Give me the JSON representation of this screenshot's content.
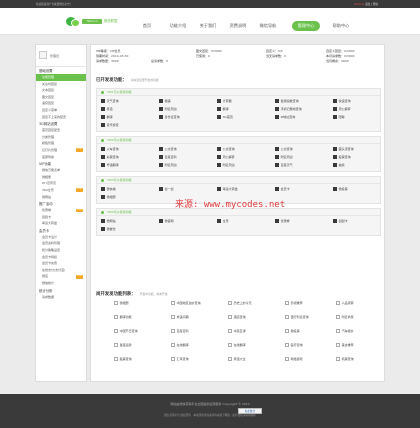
{
  "topbar": {
    "left": "欢迎您来到广告联盟微信平台！",
    "user": "adchina",
    "links": "退出 | 帮助"
  },
  "header": {
    "logo_small": "Yemx.cn",
    "logo_text": "微信联盟"
  },
  "nav": [
    "首页",
    "功能介绍",
    "关于我们",
    "资费说明",
    "微信导航",
    "管理中心",
    "帮助中心"
  ],
  "nav_active": 5,
  "sidebar": {
    "username": "管理员",
    "groups": [
      {
        "title": "基础设置",
        "items": [
          {
            "label": "功能管理",
            "sel": true
          },
          {
            "label": "关注时回复"
          },
          {
            "label": "文本回复"
          },
          {
            "label": "图文回复"
          },
          {
            "label": "语音回复"
          },
          {
            "label": "自定义菜单"
          },
          {
            "label": "回复不上来的配置"
          }
        ]
      },
      {
        "title": "3G网站设置",
        "items": [
          {
            "label": "首页回复配置"
          },
          {
            "label": "分类管理"
          },
          {
            "label": "模板管理"
          },
          {
            "label": "幻灯片管理",
            "tag": "new"
          },
          {
            "label": "底部导航"
          }
        ]
      },
      {
        "title": "VIP功能",
        "items": [
          {
            "label": "微信万能表单"
          },
          {
            "label": "微相册"
          },
          {
            "label": "DIY宣传页"
          },
          {
            "label": "360全景",
            "tag": "new"
          },
          {
            "label": "微网站"
          }
        ]
      },
      {
        "title": "推广活动",
        "items": [
          {
            "label": "优惠券",
            "tag": "new"
          },
          {
            "label": "刮刮卡"
          },
          {
            "label": "幸运大转盘"
          }
        ]
      },
      {
        "title": "会员卡",
        "items": [
          {
            "label": "会员卡设计"
          },
          {
            "label": "会员资料管理"
          },
          {
            "label": "积分策略设置"
          },
          {
            "label": "会员卡特权"
          },
          {
            "label": "会员卡充值"
          },
          {
            "label": "在线支付(支付宝)"
          },
          {
            "label": "微店",
            "tag": "new"
          },
          {
            "label": "微信统计"
          }
        ]
      },
      {
        "title": "统计分析",
        "items": [
          {
            "label": "请求数据"
          }
        ]
      }
    ]
  },
  "info": {
    "vip_label": "VIP等级：",
    "vip_value": "VIP会员",
    "expire_label": "到期时间：",
    "expire_value": "2014-03-30",
    "req_label": "请求数量：",
    "req_value": "3000",
    "gallery_label": "图文回复：",
    "gallery_value": "0/3000",
    "used_label": "已使用：",
    "used_value": "0",
    "custom_label": "自定义：",
    "custom_value": "0/5",
    "text_label": "自定义回复：",
    "text_value": "0/3000",
    "today_label": "当天请求数：",
    "today_value": "0",
    "total_label": "总请求数：",
    "total_value": "0",
    "month_label": "本月请求数：",
    "month_value": "0/3000",
    "remain_label": "当月剩余：",
    "remain_value": "3000"
  },
  "secA": {
    "title": "已开发发功能：",
    "hint": "请勾选需要开启的功能",
    "groups": [
      {
        "head": "VIP1可以使用功能",
        "opts": [
          {
            "t": "天气查询",
            "on": true
          },
          {
            "t": "糗事",
            "on": true
          },
          {
            "t": "计算器",
            "on": true
          },
          {
            "t": "健康指数查询",
            "on": true
          },
          {
            "t": "快递查询",
            "on": true
          },
          {
            "t": "笑话",
            "on": true
          },
          {
            "t": "附近周边",
            "on": true
          },
          {
            "t": "翻译",
            "on": true
          },
          {
            "t": "手机归属地查询",
            "on": true
          },
          {
            "t": "周公解梦",
            "on": true
          },
          {
            "t": "翻译",
            "on": true
          },
          {
            "t": "身份证查询",
            "on": true
          },
          {
            "t": "3G首页",
            "on": true
          },
          {
            "t": "IP地址查询",
            "on": true
          },
          {
            "t": "陪聊",
            "on": true
          },
          {
            "t": "音乐搜索",
            "on": true
          }
        ]
      },
      {
        "head": "VIP2可以使用功能",
        "opts": [
          {
            "t": "火车查询",
            "on": true
          },
          {
            "t": "公交查询",
            "on": true
          },
          {
            "t": "公交查询",
            "on": true
          },
          {
            "t": "公交查询",
            "on": true
          },
          {
            "t": "藏头诗查询",
            "on": true
          },
          {
            "t": "彩票查询",
            "on": true
          },
          {
            "t": "百度百科",
            "on": true
          },
          {
            "t": "周公解梦",
            "on": true
          },
          {
            "t": "附近周边",
            "on": true
          },
          {
            "t": "股票查询",
            "on": true
          },
          {
            "t": "粤语翻译",
            "on": true
          },
          {
            "t": "附近周边",
            "on": true
          },
          {
            "t": "附近周边",
            "on": true
          },
          {
            "t": "百度天气",
            "on": true
          },
          {
            "t": "抽奖",
            "on": true
          }
        ]
      },
      {
        "head": "VIP3可以使用功能",
        "opts": [
          {
            "t": "微信墙",
            "on": true
          },
          {
            "t": "摇一摇",
            "on": true
          },
          {
            "t": "幸运大转盘",
            "on": true
          },
          {
            "t": "会员卡",
            "on": true
          },
          {
            "t": "微投票",
            "on": true
          },
          {
            "t": "微相册",
            "on": true
          }
        ]
      },
      {
        "head": "VIP4可以使用功能",
        "opts": [
          {
            "t": "微网站",
            "on": true
          },
          {
            "t": "微官网",
            "on": true
          },
          {
            "t": "全景",
            "on": true
          },
          {
            "t": "优惠券",
            "on": true
          },
          {
            "t": "刮刮卡",
            "on": true
          },
          {
            "t": "微餐饮",
            "on": true
          }
        ]
      }
    ]
  },
  "secB": {
    "title": "尚开发发功能列表：",
    "hint": "开发中功能，尚未开放",
    "cells": [
      {
        "t": "微相册",
        "on": false
      },
      {
        "t": "中国地区油价查询",
        "on": false
      },
      {
        "t": "历史上的今天",
        "on": false
      },
      {
        "t": "影视推荐",
        "on": false
      },
      {
        "t": "人品测算",
        "on": false
      },
      {
        "t": "翻译功能",
        "on": false
      },
      {
        "t": "成语词典",
        "on": false
      },
      {
        "t": "酒店查询",
        "on": false
      },
      {
        "t": "银行利息查询",
        "on": false
      },
      {
        "t": "附近商家",
        "on": false
      },
      {
        "t": "中国节日查询",
        "on": false
      },
      {
        "t": "百度百科",
        "on": false
      },
      {
        "t": "中英互译",
        "on": false
      },
      {
        "t": "微投票",
        "on": false
      },
      {
        "t": "汽车报价",
        "on": false
      },
      {
        "t": "星座运势",
        "on": false
      },
      {
        "t": "在线翻译",
        "on": false
      },
      {
        "t": "在线翻译",
        "on": false
      },
      {
        "t": "医疗咨询",
        "on": false
      },
      {
        "t": "美食推荐",
        "on": false
      },
      {
        "t": "股票查询",
        "on": false
      },
      {
        "t": "汇率查询",
        "on": false
      },
      {
        "t": "笑话大全",
        "on": false
      },
      {
        "t": "网络游戏",
        "on": false
      },
      {
        "t": "机票查询",
        "on": false
      }
    ]
  },
  "watermark": "来源: www.mycodes.net",
  "footer": {
    "line1": "网站由微信营销平台全国提供运营服务 Copyright © 2013",
    "line2": "微信营销平台 版权所有 · 本站所提供的素材均来源于网络，如有侵权请联系删除",
    "badge": "站长统计"
  }
}
